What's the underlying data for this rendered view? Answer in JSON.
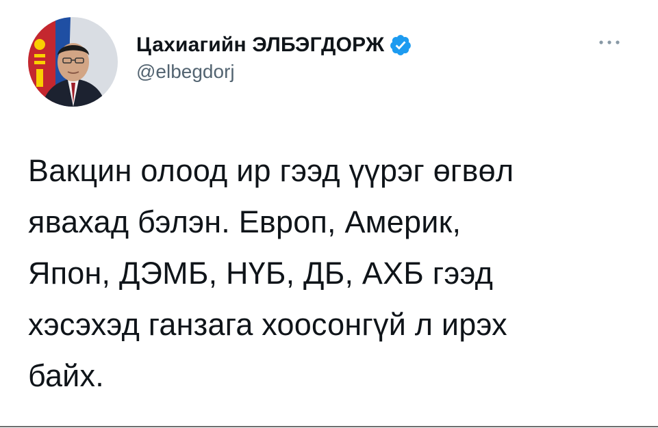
{
  "author": {
    "display_name": "Цахиагийн ЭЛБЭГДОРЖ",
    "handle": "@elbegdorj",
    "verified": true
  },
  "tweet": {
    "lines": [
      "Вакцин олоод ир гээд үүрэг өгвөл",
      "явахад бэлэн. Европ, Америк,",
      "Япон, ДЭМБ, НҮБ, ДБ, АХБ гээд",
      "хэсэхэд ганзага хоосонгүй л ирэх",
      "байх."
    ]
  },
  "icons": {
    "verified": "verified-badge-icon",
    "more": "more-options-icon"
  },
  "colors": {
    "verified_blue": "#1d9bf0",
    "secondary_text": "#536471",
    "primary_text": "#0f1419",
    "flag_red": "#c4272f",
    "flag_gold": "#f9cf02"
  }
}
